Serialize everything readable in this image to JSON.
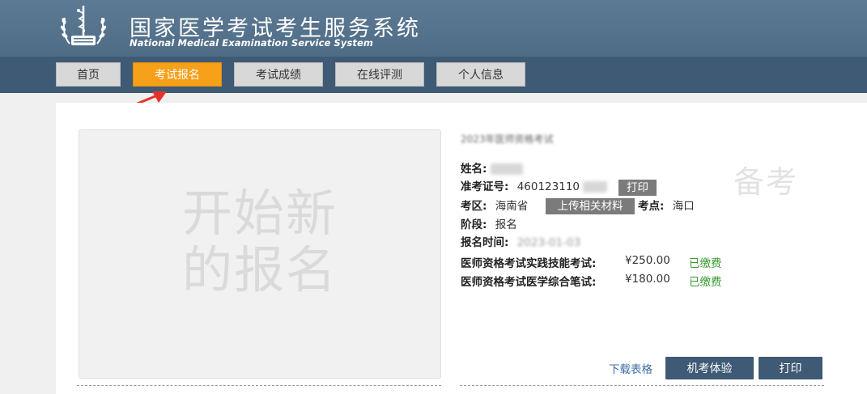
{
  "header": {
    "title_cn": "国家医学考试考生服务系统",
    "title_en": "National Medical Examination Service System",
    "logo_icon": "caduceus-emblem-icon"
  },
  "nav": {
    "items": [
      {
        "label": "首页"
      },
      {
        "label": "考试报名"
      },
      {
        "label": "考试成绩"
      },
      {
        "label": "在线评测"
      },
      {
        "label": "个人信息"
      }
    ],
    "active": "考试报名"
  },
  "new_registration": {
    "label": "开始新的报名"
  },
  "registration": {
    "exam_title": "2023年医师资格考试",
    "name_label": "姓名:",
    "ticket_label": "准考证号:",
    "ticket_value": "460123110",
    "print_ticket_label": "打印",
    "area_label": "考区:",
    "area_value": "海南省",
    "upload_label": "上传相关材料",
    "site_label": "考点:",
    "site_value": "海口",
    "stage_label": "阶段:",
    "stage_value": "报名",
    "time_label": "报名时间:",
    "time_value": "2023-01-03",
    "watermark": "备考",
    "fees": [
      {
        "name": "医师资格考试实践技能考试:",
        "amount": "¥250.00",
        "status": "已缴费"
      },
      {
        "name": "医师资格考试医学综合笔试:",
        "amount": "¥180.00",
        "status": "已缴费"
      }
    ]
  },
  "actions": {
    "download_label": "下载表格",
    "cbt_label": "机考体验",
    "print_label": "打印"
  },
  "colors": {
    "header_bg": "#56738e",
    "nav_bg": "#3e5a74",
    "active_tab": "#f7a01a",
    "annotation_arrow": "#e8302a",
    "paid_green": "#3a9a2f",
    "link_blue": "#3d6ea8"
  }
}
